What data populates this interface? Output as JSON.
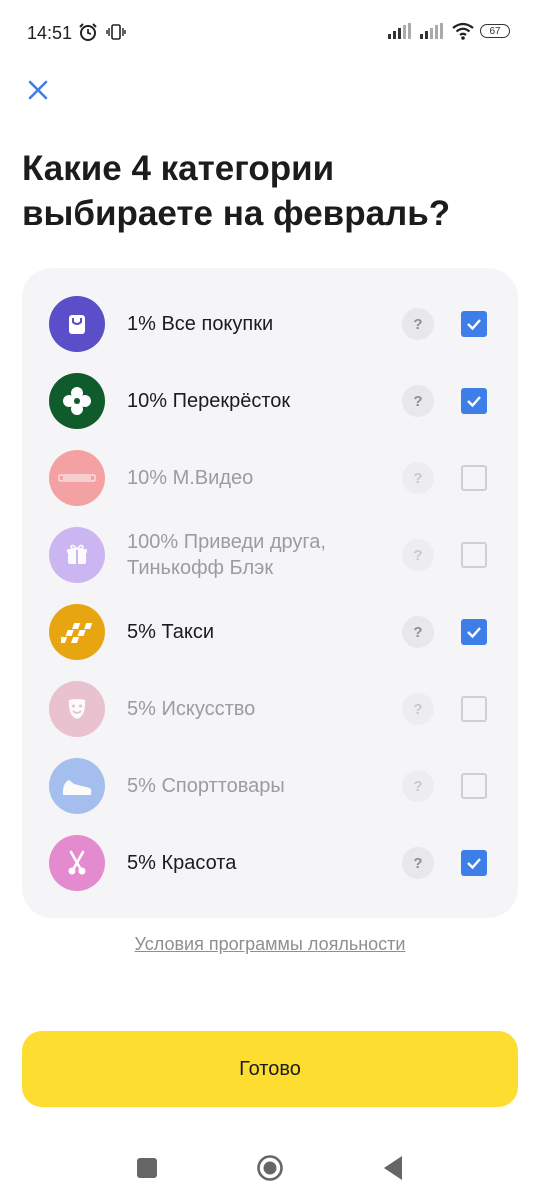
{
  "status_bar": {
    "time": "14:51",
    "battery": "67",
    "icons": [
      "alarm-icon",
      "vibration-icon",
      "signal-icon",
      "signal-icon",
      "wifi-icon",
      "battery-icon"
    ]
  },
  "header": {
    "close_icon": "close-icon",
    "title": "Какие 4 категории выбираете на февраль?"
  },
  "categories": [
    {
      "label": "1% Все покупки",
      "icon": "shopping-bag-icon",
      "color": "#5b4fc9",
      "checked": true,
      "enabled": true
    },
    {
      "label": "10% Перекрёсток",
      "icon": "perekrestok-logo-icon",
      "color": "#0f5b2b",
      "checked": true,
      "enabled": true
    },
    {
      "label": "10% М.Видео",
      "icon": "mvideo-logo-icon",
      "color": "#f26b6b",
      "checked": false,
      "enabled": false
    },
    {
      "label": "100% Приведи друга, Тинькофф Блэк",
      "icon": "gift-icon",
      "color": "#b28df0",
      "checked": false,
      "enabled": false
    },
    {
      "label": "5% Такси",
      "icon": "taxi-icon",
      "color": "#e8a512",
      "checked": true,
      "enabled": true
    },
    {
      "label": "5% Искусство",
      "icon": "theater-mask-icon",
      "color": "#e2a0b6",
      "checked": false,
      "enabled": false
    },
    {
      "label": "5% Спорттовары",
      "icon": "sneaker-icon",
      "color": "#6f9be8",
      "checked": false,
      "enabled": false
    },
    {
      "label": "5% Красота",
      "icon": "scissors-icon",
      "color": "#e48bd0",
      "checked": true,
      "enabled": true
    }
  ],
  "help_label": "?",
  "loyalty_link": "Условия программы лояльности",
  "done_button": "Готово",
  "nav_bar": [
    "recents-icon",
    "home-icon",
    "back-icon"
  ],
  "colors": {
    "accent": "#3e7ee8",
    "primary_button": "#fddd2f",
    "card_bg": "#f5f5f7"
  }
}
